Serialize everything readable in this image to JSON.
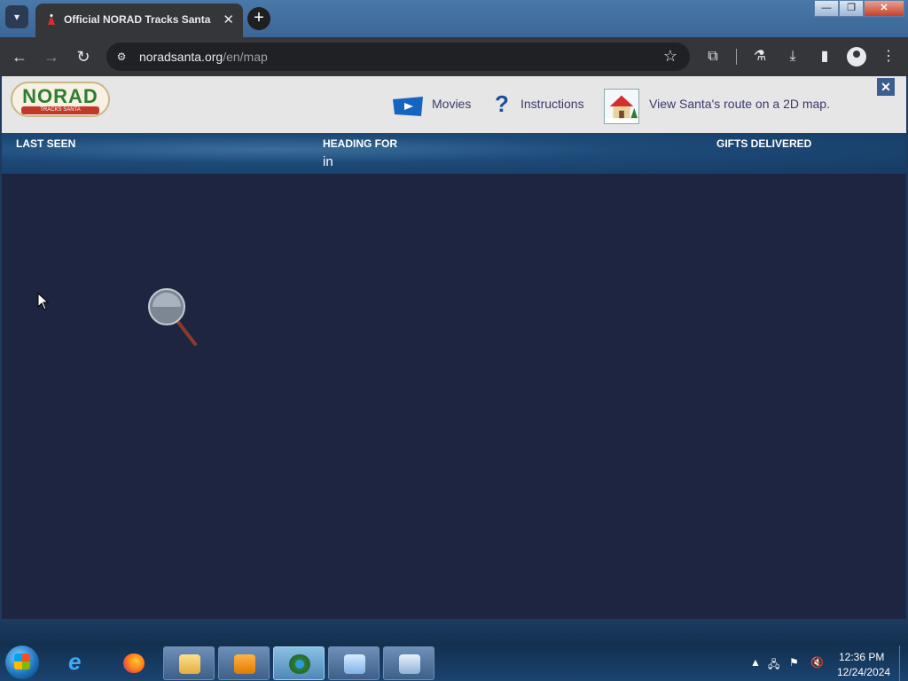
{
  "browser": {
    "tab_title": "Official NORAD Tracks Santa",
    "url_domain": "noradsanta.org",
    "url_path": "/en/map",
    "window_min": "—",
    "window_max": "❐",
    "window_close": "✕"
  },
  "header": {
    "logo_text": "NORAD",
    "logo_sub": "TRACKS SANTA",
    "movies_label": "Movies",
    "instructions_label": "Instructions",
    "map_label": "View Santa's route on a 2D map.",
    "close": "✕"
  },
  "stats": {
    "last_seen_label": "LAST SEEN",
    "last_seen_value": "",
    "heading_for_label": "HEADING FOR",
    "heading_for_value": "in",
    "gifts_label": "GIFTS DELIVERED",
    "gifts_value": ""
  },
  "taskbar": {
    "time": "12:36 PM",
    "date": "12/24/2024"
  },
  "colors": {
    "page_bg": "#1e2540",
    "header_bg": "#e6e6e6",
    "stats_band": "#1d4a78",
    "toolbar": "#35363a"
  }
}
